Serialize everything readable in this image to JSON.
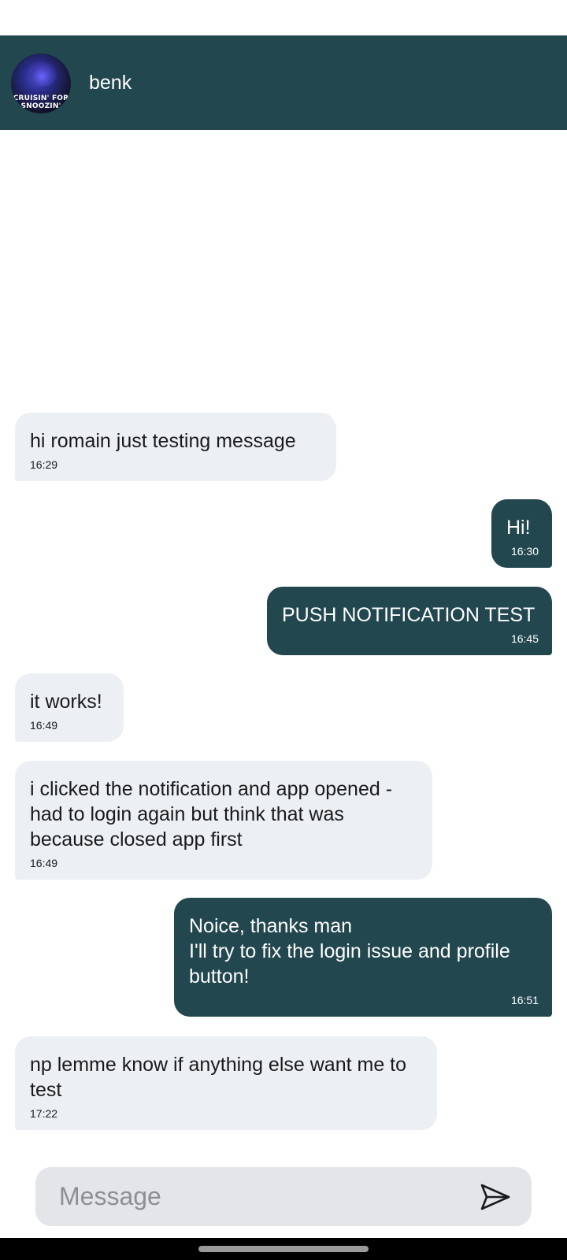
{
  "header": {
    "contact_name": "benk",
    "avatar_text": "CRUISIN' FOR\nSNOOZIN'"
  },
  "messages": [
    {
      "direction": "in",
      "text": "hi romain just testing message",
      "time": "16:29"
    },
    {
      "direction": "out",
      "text": "Hi!",
      "time": "16:30"
    },
    {
      "direction": "out",
      "text": "PUSH NOTIFICATION TEST",
      "time": "16:45"
    },
    {
      "direction": "in",
      "text": "it works!",
      "time": "16:49"
    },
    {
      "direction": "in",
      "text": "i clicked the notification and app opened - had to login again but think that was because closed app first",
      "time": "16:49"
    },
    {
      "direction": "out",
      "text": "Noice, thanks man\nI'll try to fix the login issue and profile button!",
      "time": "16:51"
    },
    {
      "direction": "in",
      "text": "np lemme know if anything else want me to test",
      "time": "17:22"
    }
  ],
  "composer": {
    "placeholder": "Message",
    "value": "",
    "send_icon": "send-icon"
  },
  "colors": {
    "header_bg": "#22474f",
    "outgoing_bubble": "#22474f",
    "incoming_bubble": "#ecf0f4",
    "composer_bg": "#e3e5e9"
  }
}
